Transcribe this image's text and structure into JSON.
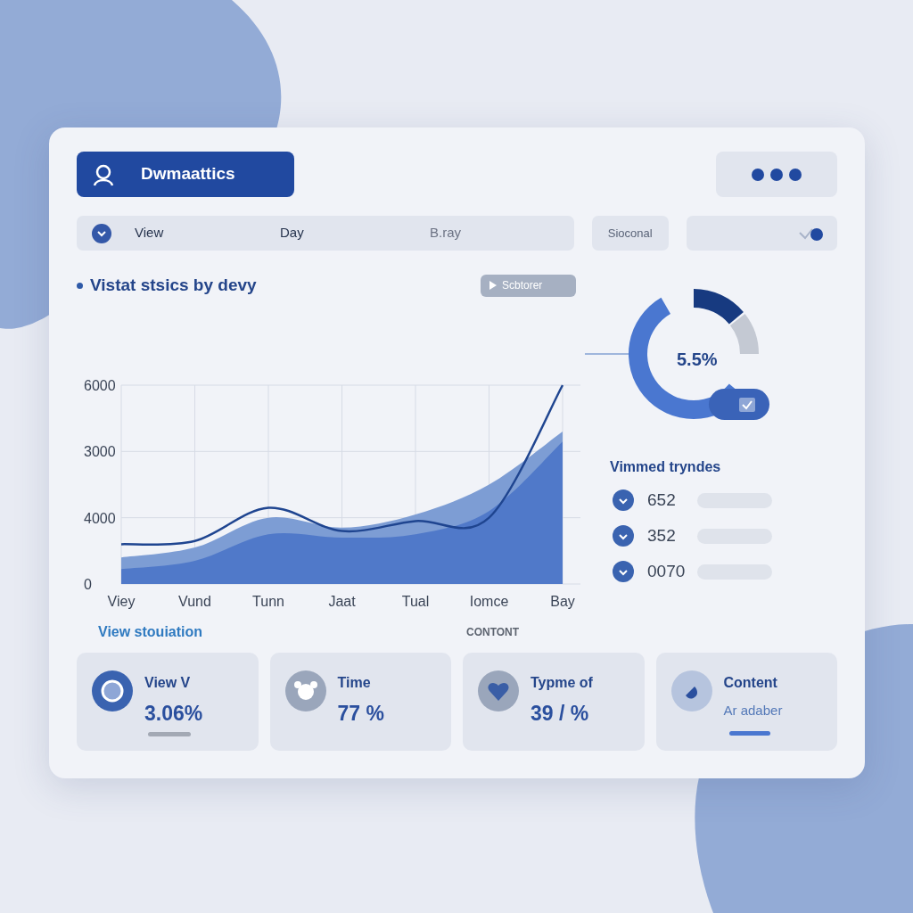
{
  "header": {
    "brand": "Dwmaattics"
  },
  "filters": {
    "items": [
      "View",
      "Day",
      "B.ray"
    ],
    "select": "Sioconal"
  },
  "chart_panel": {
    "title": "Vistat stsics by devy",
    "action": "Scbtorer",
    "chart_data": {
      "type": "area",
      "categories": [
        "Viey",
        "Vund",
        "Tunn",
        "Jaat",
        "Tual",
        "Iomce",
        "Bay"
      ],
      "ylim": [
        0,
        6000
      ],
      "yticks": [
        6000,
        0
      ],
      "grid": true,
      "series": [
        {
          "color": "#7d9dd4",
          "values": [
            800,
            1100,
            2000,
            1700,
            2100,
            3000,
            4600
          ]
        },
        {
          "color": "#5079c9",
          "values": [
            450,
            700,
            1500,
            1400,
            1500,
            2200,
            4300
          ]
        },
        {
          "type": "line",
          "color": "#1f4590",
          "values": [
            1200,
            1300,
            2300,
            1600,
            1900,
            2000,
            6000
          ]
        }
      ]
    },
    "middle_axis_labels": [
      "3000",
      "4000"
    ]
  },
  "donut": {
    "center": "5.5%",
    "checked": true
  },
  "trends": {
    "title": "Vimmed tryndes",
    "rows": [
      "652",
      "352",
      "0070"
    ]
  },
  "summary": {
    "title": "View stouiation",
    "label": "CONTONT",
    "cards": [
      {
        "label": "View V",
        "value": "3.06%"
      },
      {
        "label": "Time",
        "value": "77 %"
      },
      {
        "label": "Typme of",
        "value": "39 / %"
      },
      {
        "label": "Content",
        "subtitle": "Ar adaber"
      }
    ]
  }
}
